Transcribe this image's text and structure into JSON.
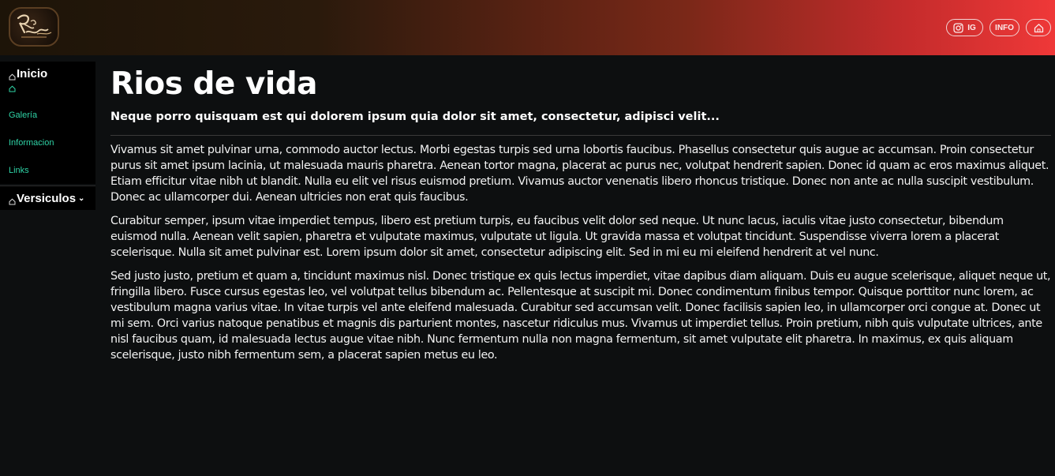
{
  "header": {
    "logo_alt": "Rios de Vida",
    "buttons": [
      {
        "label": "IG",
        "icon": "instagram-icon"
      },
      {
        "label": "INFO"
      },
      {
        "icon": "home-icon"
      }
    ]
  },
  "sidebar": {
    "inicio_label": "Inicio",
    "home_icon": "home-icon",
    "links": [
      "Galería",
      "Informacion",
      "Links"
    ],
    "versiculos_label": "Versiculos",
    "link_color": "#2fd3a6"
  },
  "main": {
    "title": "Rios de vida",
    "subtitle": "Neque porro quisquam est qui dolorem ipsum quia dolor sit amet, consectetur, adipisci velit...",
    "paragraphs": [
      "Vivamus sit amet pulvinar urna, commodo auctor lectus. Morbi egestas turpis sed urna lobortis faucibus. Phasellus consectetur quis augue ac accumsan. Proin consectetur purus sit amet ipsum lacinia, ut malesuada mauris pharetra. Aenean tortor magna, placerat ac purus nec, volutpat hendrerit sapien. Donec id quam ac eros maximus aliquet. Etiam efficitur vitae nibh ut blandit. Nulla eu elit vel risus euismod pretium. Vivamus auctor venenatis libero rhoncus tristique. Donec non ante ac nulla suscipit vestibulum. Donec ac ullamcorper dui. Aenean ultricies non erat quis faucibus.",
      "Curabitur semper, ipsum vitae imperdiet tempus, libero est pretium turpis, eu faucibus velit dolor sed neque. Ut nunc lacus, iaculis vitae justo consectetur, bibendum euismod nulla. Aenean velit sapien, pharetra et vulputate maximus, vulputate ut ligula. Ut gravida massa et volutpat tincidunt. Suspendisse viverra lorem a placerat scelerisque. Nulla sit amet pulvinar est. Lorem ipsum dolor sit amet, consectetur adipiscing elit. Sed in mi eu mi eleifend hendrerit at vel nunc.",
      "Sed justo justo, pretium et quam a, tincidunt maximus nisl. Donec tristique ex quis lectus imperdiet, vitae dapibus diam aliquam. Duis eu augue scelerisque, aliquet neque ut, fringilla libero. Fusce cursus egestas leo, vel volutpat tellus bibendum ac. Pellentesque at suscipit mi. Donec condimentum finibus tempor. Quisque porttitor nunc lorem, ac vestibulum magna varius vitae. In vitae turpis vel ante eleifend malesuada. Curabitur sed accumsan velit. Donec facilisis sapien leo, in ullamcorper orci congue at. Donec ut mi sem. Orci varius natoque penatibus et magnis dis parturient montes, nascetur ridiculus mus. Vivamus ut imperdiet tellus. Proin pretium, nibh quis vulputate ultrices, ante nisl faucibus quam, id malesuada lectus augue vitae nibh. Nunc fermentum nulla non magna fermentum, sit amet vulputate elit pharetra. In maximus, ex quis aliquam scelerisque, justo nibh fermentum sem, a placerat sapien metus eu leo."
    ]
  }
}
